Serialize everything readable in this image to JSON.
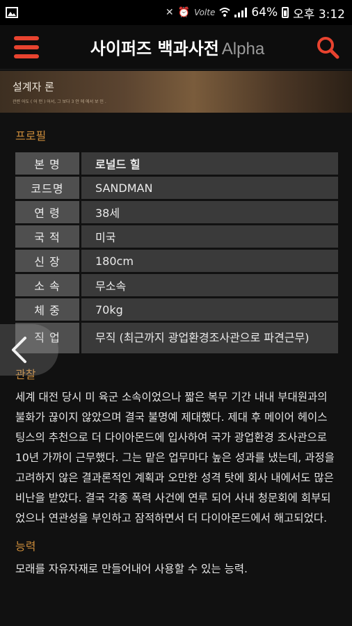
{
  "status_bar": {
    "battery": "64%",
    "time": "오후 3:12",
    "volte": "Volte",
    "icons": [
      "image-icon",
      "mute-icon",
      "alarm-icon",
      "wifi-icon",
      "signal-icon",
      "battery-icon"
    ]
  },
  "app_bar": {
    "title": "사이퍼즈 백과사전",
    "subtitle": "Alpha",
    "accent_color": "#e8432f"
  },
  "banner": {
    "title": "설계자 론",
    "subtitle": "관련 어도 ( 어 떤 ) 어서, 그 보다 3 안 에 에서 보 인 ."
  },
  "profile": {
    "heading": "프로필",
    "rows": [
      {
        "key": "본 명",
        "value": "로널드 힐"
      },
      {
        "key": "코드명",
        "value": "SANDMAN"
      },
      {
        "key": "연 령",
        "value": "38세"
      },
      {
        "key": "국 적",
        "value": "미국"
      },
      {
        "key": "신 장",
        "value": "180cm"
      },
      {
        "key": "소 속",
        "value": "무소속"
      },
      {
        "key": "체 중",
        "value": "70kg"
      },
      {
        "key": "직 업",
        "value": "무직 (최근까지 광업환경조사관으로 파견근무)"
      }
    ]
  },
  "observation": {
    "heading": "관찰",
    "text": "세계 대전 당시 미 육군 소속이었으나 짧은 복무 기간 내내 부대원과의 불화가 끊이지 않았으며 결국 불명예 제대했다. 제대 후 메이어 헤이스팅스의 추천으로 더 다이아몬드에 입사하여 국가 광업환경 조사관으로 10년 가까이 근무했다. 그는 맡은 업무마다 높은 성과를 냈는데, 과정을 고려하지 않은 결과론적인 계획과 오만한 성격 탓에 회사 내에서도 많은 비난을 받았다. 결국 각종 폭력 사건에 연루 되어 사내 청문회에 회부되었으나 연관성을 부인하고 잠적하면서 더 다이아몬드에서 해고되었다."
  },
  "ability": {
    "heading": "능력",
    "text": "모래를 자유자재로 만들어내어 사용할 수 있는 능력."
  }
}
